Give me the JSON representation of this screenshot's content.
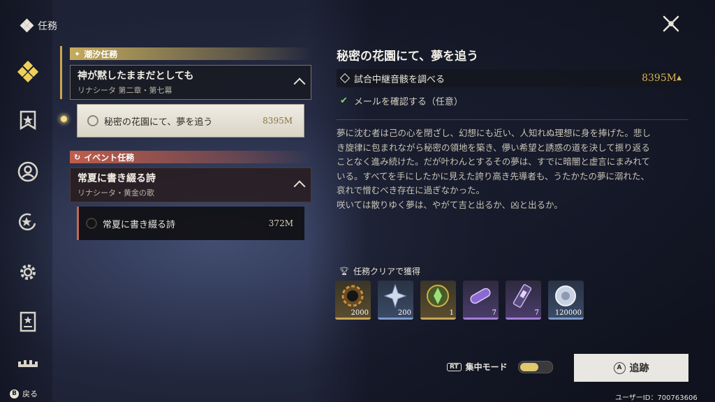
{
  "header": {
    "title": "任務"
  },
  "categories": {
    "tide": {
      "label": "潮汐任務"
    },
    "event": {
      "label": "イベント任務"
    }
  },
  "groups": [
    {
      "title": "神が黙したままだとしても",
      "subtitle": "リナシータ 第二章・第七幕",
      "items": [
        {
          "label": "秘密の花園にて、夢を追う",
          "distance": "8395M"
        }
      ]
    },
    {
      "title": "常夏に書き綴る詩",
      "subtitle": "リナシータ・黄金の歌",
      "items": [
        {
          "label": "常夏に書き綴る詩",
          "distance": "372M"
        }
      ]
    }
  ],
  "detail": {
    "title": "秘密の花園にて、夢を追う",
    "objective": {
      "label": "試合中継音骸を調べる",
      "distance": "8395M"
    },
    "optional": {
      "label": "メールを確認する（任意）"
    },
    "description": [
      "夢に沈む者は己の心を閉ざし、幻想にも近い、人知れぬ理想に身を捧げた。悲し",
      "き旋律に包まれながら秘密の領地を築き、儚い希望と誘惑の道を決して振り返る",
      "ことなく進み続けた。だが叶わんとするその夢は、すでに暗闇と虚言にまみれて",
      "いる。すべてを手にしたかに見えた誇り高き先導者も、うたかたの夢に溺れた、",
      "哀れで憎むべき存在に過ぎなかった。",
      "咲いては散りゆく夢は、やがて吉と出るか、凶と出るか。"
    ],
    "rewards_label": "任務クリアで獲得",
    "rewards": [
      {
        "icon": "shell-credit-icon",
        "qty": "2000",
        "rarity": "gold"
      },
      {
        "icon": "star-shard-icon",
        "qty": "200",
        "rarity": "blue"
      },
      {
        "icon": "tide-crystal-icon",
        "qty": "1",
        "rarity": "gold"
      },
      {
        "icon": "capsule-icon",
        "qty": "7",
        "rarity": "purple"
      },
      {
        "icon": "canister-icon",
        "qty": "7",
        "rarity": "purple"
      },
      {
        "icon": "disc-icon",
        "qty": "120000",
        "rarity": "blue"
      }
    ]
  },
  "footer": {
    "rt_key": "RT",
    "focus_label": "集中モード",
    "a_key": "A",
    "track_label": "追跡",
    "b_key": "B",
    "back_label": "戻る",
    "user_id": "ユーザーID：700763606"
  }
}
